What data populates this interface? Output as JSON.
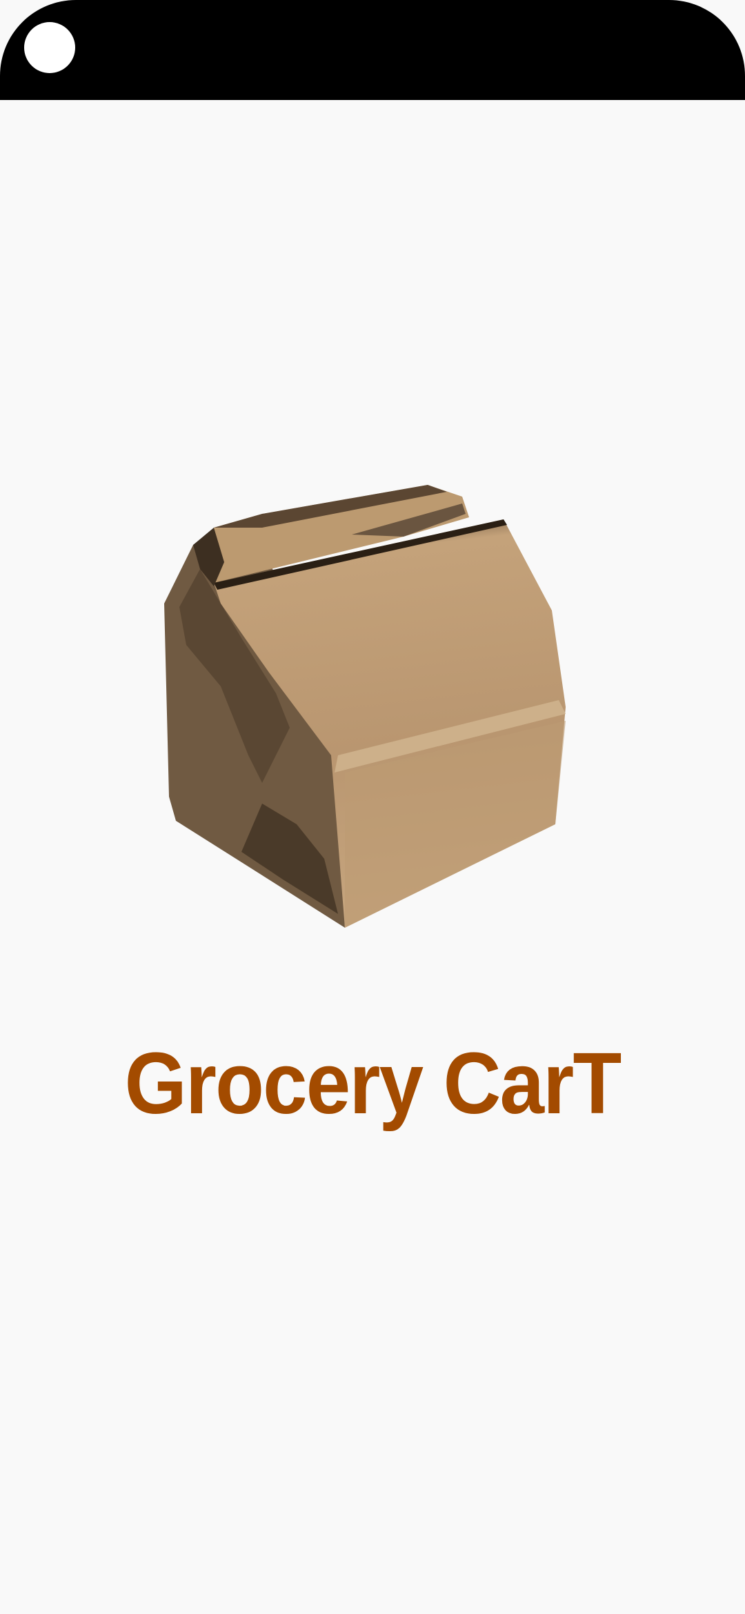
{
  "app": {
    "title": "Grocery CarT"
  },
  "splash": {
    "image": "paper-grocery-bag",
    "title_color": "#a34b00"
  }
}
